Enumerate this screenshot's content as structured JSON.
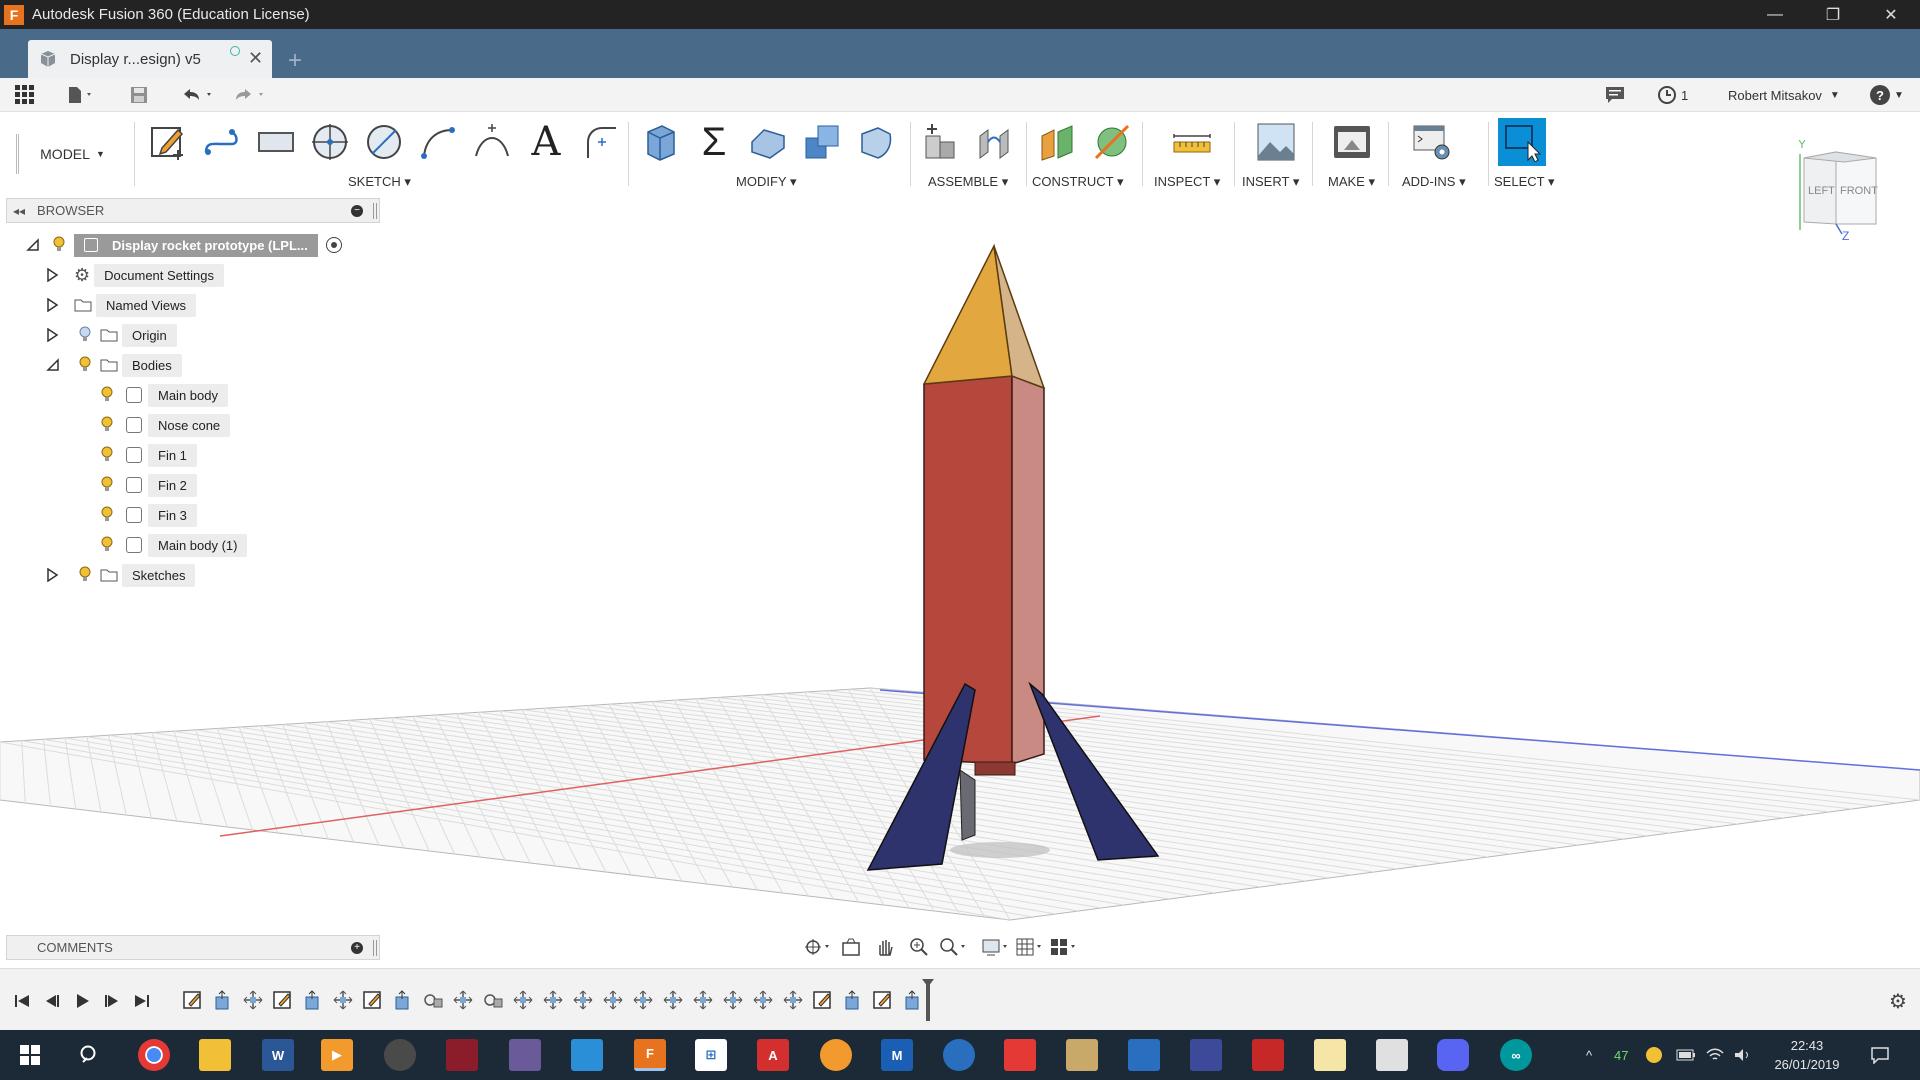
{
  "window": {
    "title": "Autodesk Fusion 360 (Education License)",
    "minimize": "—",
    "restore": "❐",
    "close": "✕"
  },
  "tabs": {
    "active_label": "Display r...esign) v5",
    "close": "✕",
    "new_tab": "+"
  },
  "quick_access": {
    "user_name": "Robert Mitsakov",
    "jobs_count": "1",
    "help": "?"
  },
  "ribbon": {
    "workspace": "MODEL",
    "groups": {
      "sketch": "SKETCH",
      "modify": "MODIFY",
      "assemble": "ASSEMBLE",
      "construct": "CONSTRUCT",
      "inspect": "INSPECT",
      "insert": "INSERT",
      "make": "MAKE",
      "addins": "ADD-INS",
      "select": "SELECT"
    },
    "text_tool": "A",
    "sum_tool": "Σ"
  },
  "viewcube": {
    "left": "LEFT",
    "front": "FRONT",
    "y_axis": "Y",
    "z_axis": "Z"
  },
  "browser": {
    "title": "BROWSER",
    "root": "Display rocket prototype (LPL...",
    "nodes": {
      "document_settings": "Document Settings",
      "named_views": "Named Views",
      "origin": "Origin",
      "bodies": "Bodies",
      "sketches": "Sketches"
    },
    "bodies": [
      "Main body",
      "Nose cone",
      "Fin 1",
      "Fin 2",
      "Fin 3",
      "Main body (1)"
    ]
  },
  "comments": {
    "title": "COMMENTS"
  },
  "taskbar": {
    "clock_time": "22:43",
    "clock_date": "26/01/2019",
    "tray_badge": "47"
  },
  "colors": {
    "titlebar": "#232323",
    "tabbar": "#4a6a8a",
    "nose_cone": "#e3a740",
    "main_body": "#b5473c",
    "fins": "#2e336d",
    "select_accent": "#0a8fd6",
    "taskbar": "#1c2a38"
  }
}
